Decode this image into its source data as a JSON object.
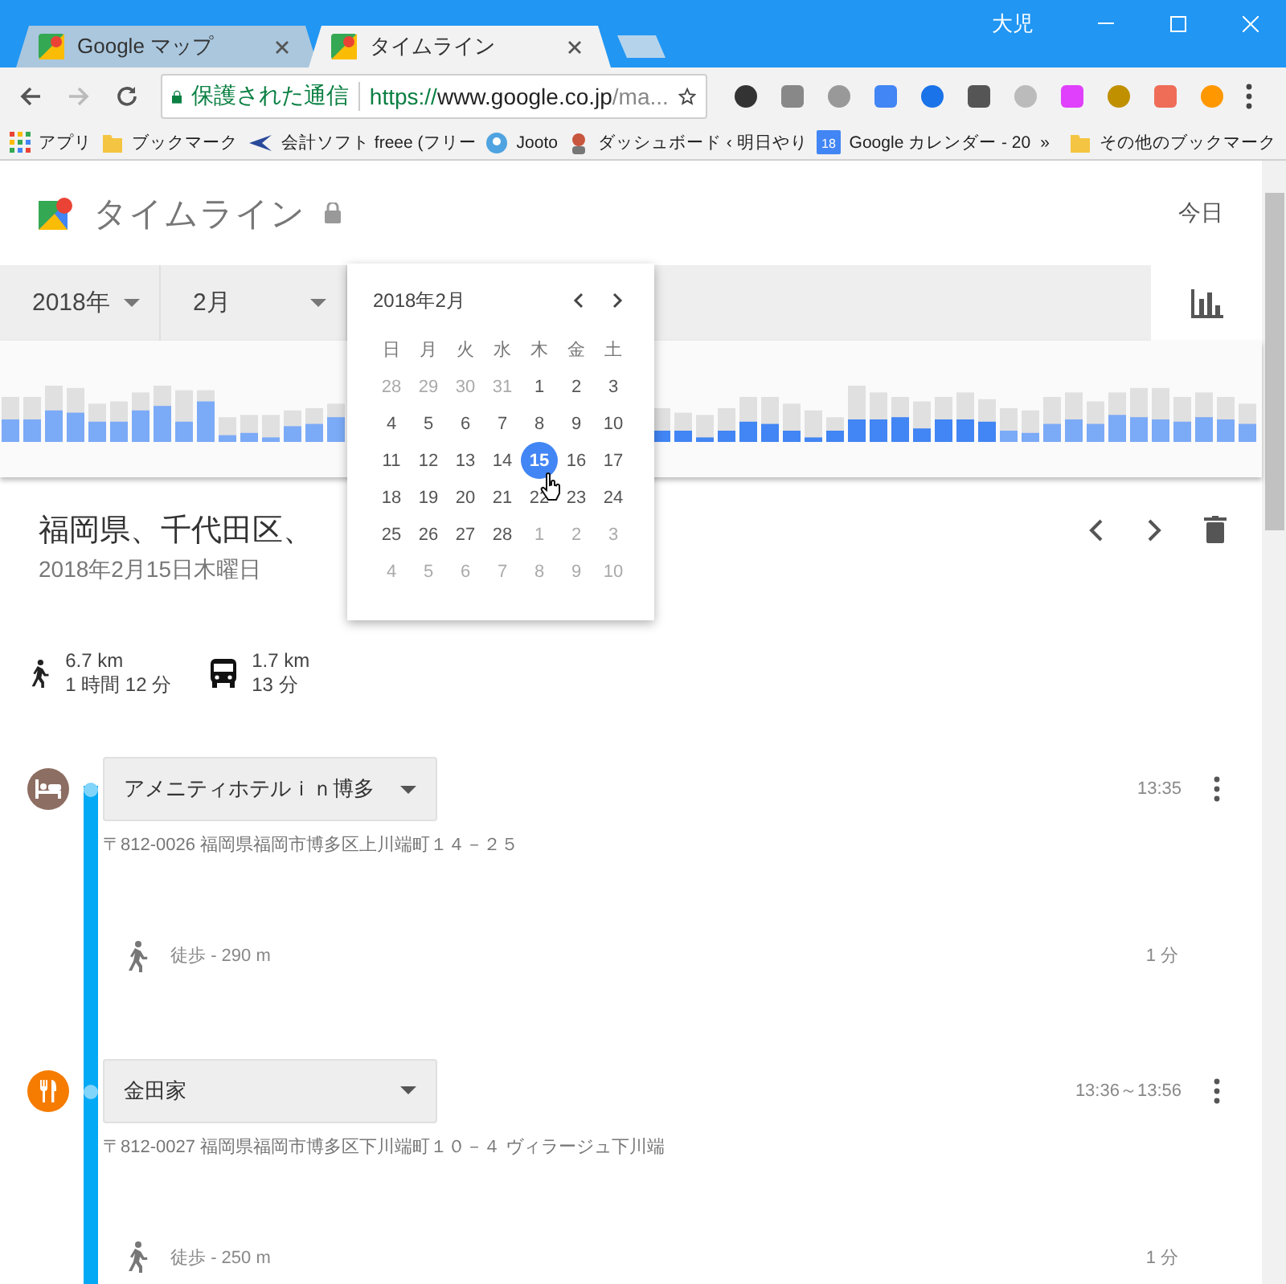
{
  "browser": {
    "profile": "大児",
    "tabs": [
      {
        "title": "Google マップ",
        "selected": false
      },
      {
        "title": "タイムライン",
        "selected": true
      }
    ],
    "security_label": "保護された通信",
    "url": {
      "scheme": "https://",
      "host": "www.google.co.jp",
      "path": "/ma..."
    },
    "bookmarks": [
      {
        "kind": "apps",
        "label": "アプリ"
      },
      {
        "kind": "folder",
        "label": "ブックマーク"
      },
      {
        "kind": "plane",
        "label": "会計ソフト freee (フリー"
      },
      {
        "kind": "globe",
        "label": "Jooto"
      },
      {
        "kind": "person",
        "label": "ダッシュボード ‹ 明日やり"
      },
      {
        "kind": "calendar",
        "label": "Google カレンダー - 20",
        "badge": "18"
      }
    ],
    "overflow": "»",
    "other_bookmarks": "その他のブックマーク"
  },
  "page": {
    "title": "タイムライン",
    "today": "今日",
    "year": "2018年",
    "month": "2月"
  },
  "calendar": {
    "title": "2018年2月",
    "weekdays": [
      "日",
      "月",
      "火",
      "水",
      "木",
      "金",
      "土"
    ],
    "days": [
      {
        "label": "28",
        "muted": true,
        "selected": false
      },
      {
        "label": "29",
        "muted": true,
        "selected": false
      },
      {
        "label": "30",
        "muted": true,
        "selected": false
      },
      {
        "label": "31",
        "muted": true,
        "selected": false
      },
      {
        "label": "1",
        "muted": false,
        "selected": false
      },
      {
        "label": "2",
        "muted": false,
        "selected": false
      },
      {
        "label": "3",
        "muted": false,
        "selected": false
      },
      {
        "label": "4",
        "muted": false,
        "selected": false
      },
      {
        "label": "5",
        "muted": false,
        "selected": false
      },
      {
        "label": "6",
        "muted": false,
        "selected": false
      },
      {
        "label": "7",
        "muted": false,
        "selected": false
      },
      {
        "label": "8",
        "muted": false,
        "selected": false
      },
      {
        "label": "9",
        "muted": false,
        "selected": false
      },
      {
        "label": "10",
        "muted": false,
        "selected": false
      },
      {
        "label": "11",
        "muted": false,
        "selected": false
      },
      {
        "label": "12",
        "muted": false,
        "selected": false
      },
      {
        "label": "13",
        "muted": false,
        "selected": false
      },
      {
        "label": "14",
        "muted": false,
        "selected": false
      },
      {
        "label": "15",
        "muted": false,
        "selected": true
      },
      {
        "label": "16",
        "muted": false,
        "selected": false
      },
      {
        "label": "17",
        "muted": false,
        "selected": false
      },
      {
        "label": "18",
        "muted": false,
        "selected": false
      },
      {
        "label": "19",
        "muted": false,
        "selected": false
      },
      {
        "label": "20",
        "muted": false,
        "selected": false
      },
      {
        "label": "21",
        "muted": false,
        "selected": false
      },
      {
        "label": "22",
        "muted": false,
        "selected": false
      },
      {
        "label": "23",
        "muted": false,
        "selected": false
      },
      {
        "label": "24",
        "muted": false,
        "selected": false
      },
      {
        "label": "25",
        "muted": false,
        "selected": false
      },
      {
        "label": "26",
        "muted": false,
        "selected": false
      },
      {
        "label": "27",
        "muted": false,
        "selected": false
      },
      {
        "label": "28",
        "muted": false,
        "selected": false
      },
      {
        "label": "1",
        "muted": true,
        "selected": false
      },
      {
        "label": "2",
        "muted": true,
        "selected": false
      },
      {
        "label": "3",
        "muted": true,
        "selected": false
      },
      {
        "label": "4",
        "muted": true,
        "selected": false
      },
      {
        "label": "5",
        "muted": true,
        "selected": false
      },
      {
        "label": "6",
        "muted": true,
        "selected": false
      },
      {
        "label": "7",
        "muted": true,
        "selected": false
      },
      {
        "label": "8",
        "muted": true,
        "selected": false
      },
      {
        "label": "9",
        "muted": true,
        "selected": false
      },
      {
        "label": "10",
        "muted": true,
        "selected": false
      }
    ]
  },
  "day": {
    "place": "福岡県、千代田区、",
    "date": "2018年2月15日木曜日"
  },
  "summary": [
    {
      "kind": "walk",
      "distance": "6.7 km",
      "duration": "1 時間 12 分"
    },
    {
      "kind": "bus",
      "distance": "1.7 km",
      "duration": "13 分"
    }
  ],
  "timeline": [
    {
      "kind": "hotel",
      "color": "#8d6e63",
      "name": "アメニティホテルｉｎ博多",
      "time": "13:35",
      "address": "〒812-0026 福岡県福岡市博多区上川端町１４－２５"
    },
    {
      "kind": "move",
      "label": "徒歩",
      "distance": "- 290 m",
      "duration": "1 分"
    },
    {
      "kind": "restaurant",
      "color": "#f57c00",
      "name": "金田家",
      "time": "13:36～13:56",
      "address": "〒812-0027 福岡県福岡市博多区下川端町１０－４ ヴィラージュ下川端"
    },
    {
      "kind": "move",
      "label": "徒歩",
      "distance": "- 250 m",
      "duration": "1 分"
    }
  ]
}
